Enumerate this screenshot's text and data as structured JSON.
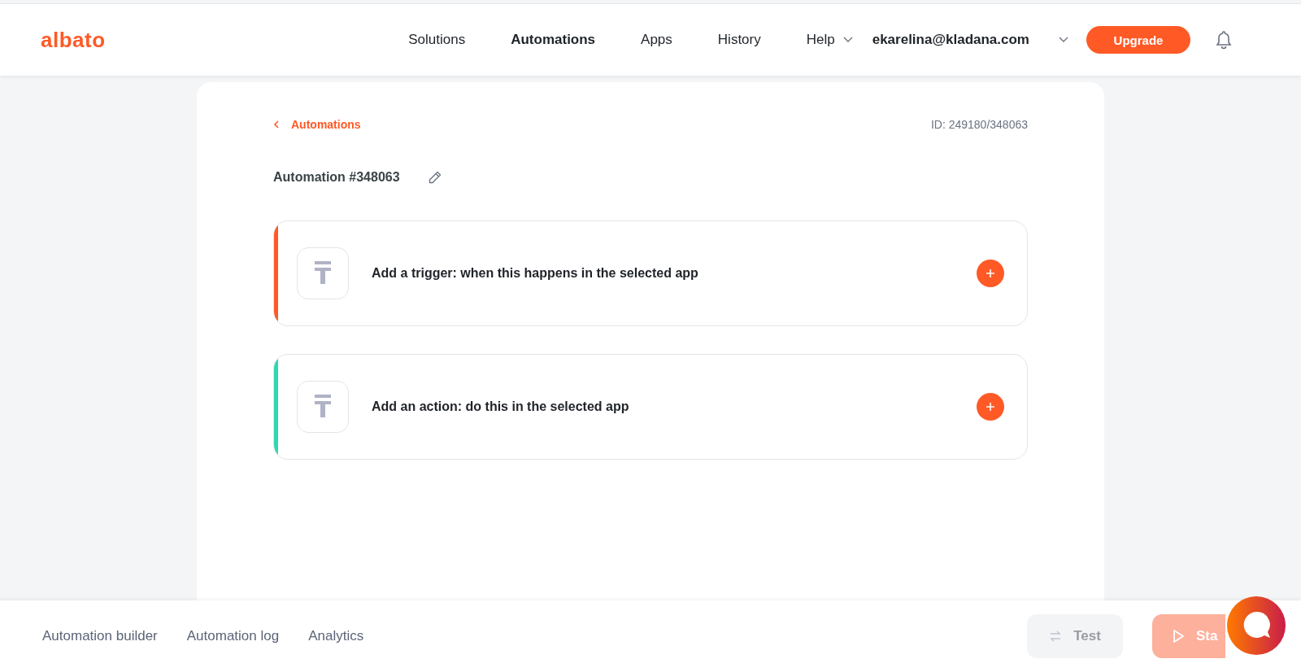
{
  "header": {
    "logo": "albato",
    "nav": [
      {
        "label": "Solutions",
        "selected": false,
        "dropdown": false
      },
      {
        "label": "Automations",
        "selected": true,
        "dropdown": false
      },
      {
        "label": "Apps",
        "selected": false,
        "dropdown": false
      },
      {
        "label": "History",
        "selected": false,
        "dropdown": false
      },
      {
        "label": "Help",
        "selected": false,
        "dropdown": true
      }
    ],
    "account": "ekarelina@kladana.com",
    "upgrade": "Upgrade"
  },
  "back_link": "Automations",
  "id_label": "ID: 249180/348063",
  "title": "Automation #348063",
  "steps": [
    {
      "label": "Add a trigger: when this happens in the selected app",
      "color": "#ff5a26"
    },
    {
      "label": "Add an action: do this in the selected app",
      "color": "#2fd8b0"
    }
  ],
  "footer": {
    "tabs": [
      {
        "label": "Automation builder",
        "selected": false
      },
      {
        "label": "Automation log",
        "selected": false
      },
      {
        "label": "Analytics",
        "selected": false
      }
    ],
    "buttons": [
      {
        "kind": "test",
        "label": "Test",
        "disabled": true
      },
      {
        "kind": "start",
        "label": "Sta",
        "disabled": true
      }
    ]
  }
}
